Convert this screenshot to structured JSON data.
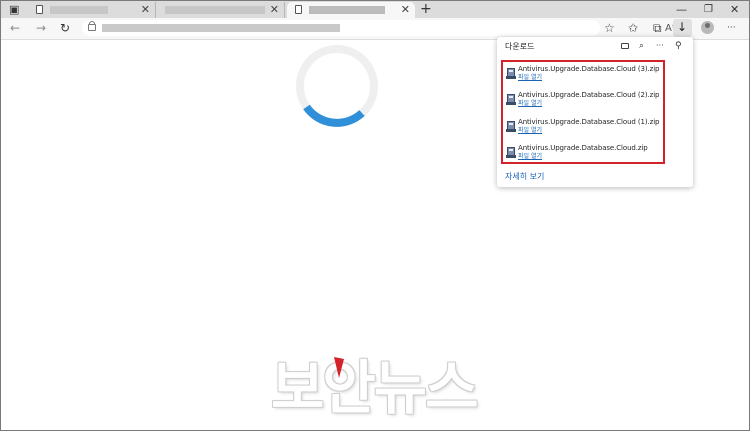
{
  "window": {
    "minimize_glyph": "—",
    "maximize_glyph": "❐",
    "close_glyph": "✕"
  },
  "tabs": [
    {
      "close_glyph": "✕",
      "active": false
    },
    {
      "close_glyph": "✕",
      "active": false
    },
    {
      "close_glyph": "✕",
      "active": true
    }
  ],
  "new_tab_glyph": "+",
  "toolbar": {
    "back_glyph": "←",
    "forward_glyph": "→",
    "refresh_glyph": "↻",
    "reader_glyph": "Aˢ",
    "favorite_glyph": "☆",
    "favorites_glyph": "✩",
    "collections_glyph": "⧉",
    "download_glyph": "↓",
    "more_glyph": "···"
  },
  "downloads": {
    "heading": "다운로드",
    "search_glyph": "⌕",
    "more_glyph": "···",
    "pin_glyph": "⚲",
    "items": [
      {
        "filename": "Antivirus.Upgrade.Database.Cloud (3).zip",
        "action": "파일 열기"
      },
      {
        "filename": "Antivirus.Upgrade.Database.Cloud (2).zip",
        "action": "파일 열기"
      },
      {
        "filename": "Antivirus.Upgrade.Database.Cloud (1).zip",
        "action": "파일 열기"
      },
      {
        "filename": "Antivirus.Upgrade.Database.Cloud.zip",
        "action": "파일 열기"
      }
    ],
    "see_more": "자세히 보기"
  },
  "watermark": "보안뉴스",
  "colors": {
    "highlight_border": "#d2232a",
    "link": "#1a63b5",
    "spinner_track": "#efefef",
    "spinner_arc": "#2f8fd8"
  }
}
